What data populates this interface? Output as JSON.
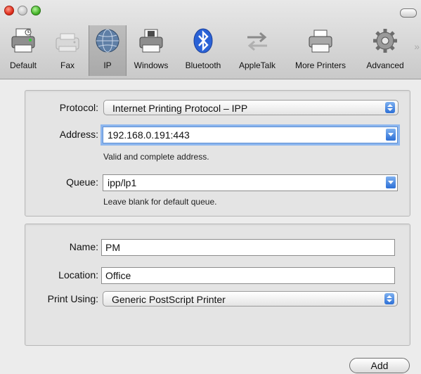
{
  "toolbar": {
    "items": [
      {
        "label": "Default",
        "icon": "printer-icon"
      },
      {
        "label": "Fax",
        "icon": "fax-icon"
      },
      {
        "label": "IP",
        "icon": "globe-icon"
      },
      {
        "label": "Windows",
        "icon": "windows-printer-icon"
      },
      {
        "label": "Bluetooth",
        "icon": "bluetooth-icon"
      },
      {
        "label": "AppleTalk",
        "icon": "appletalk-arrows-icon"
      },
      {
        "label": "More Printers",
        "icon": "more-printers-icon"
      },
      {
        "label": "Advanced",
        "icon": "gear-icon"
      }
    ],
    "selected": "IP"
  },
  "connection": {
    "protocol_label": "Protocol:",
    "protocol_value": "Internet Printing Protocol – IPP",
    "address_label": "Address:",
    "address_value": "192.168.0.191:443",
    "address_hint": "Valid and complete address.",
    "queue_label": "Queue:",
    "queue_value": "ipp/lp1",
    "queue_hint": "Leave blank for default queue."
  },
  "details": {
    "name_label": "Name:",
    "name_value": "PM",
    "location_label": "Location:",
    "location_value": "Office",
    "print_using_label": "Print Using:",
    "print_using_value": "Generic PostScript Printer"
  },
  "actions": {
    "add_label": "Add"
  },
  "colors": {
    "accent": "#2c6fd6",
    "focus_ring": "#8db6ee",
    "window_bg": "#ececec"
  }
}
